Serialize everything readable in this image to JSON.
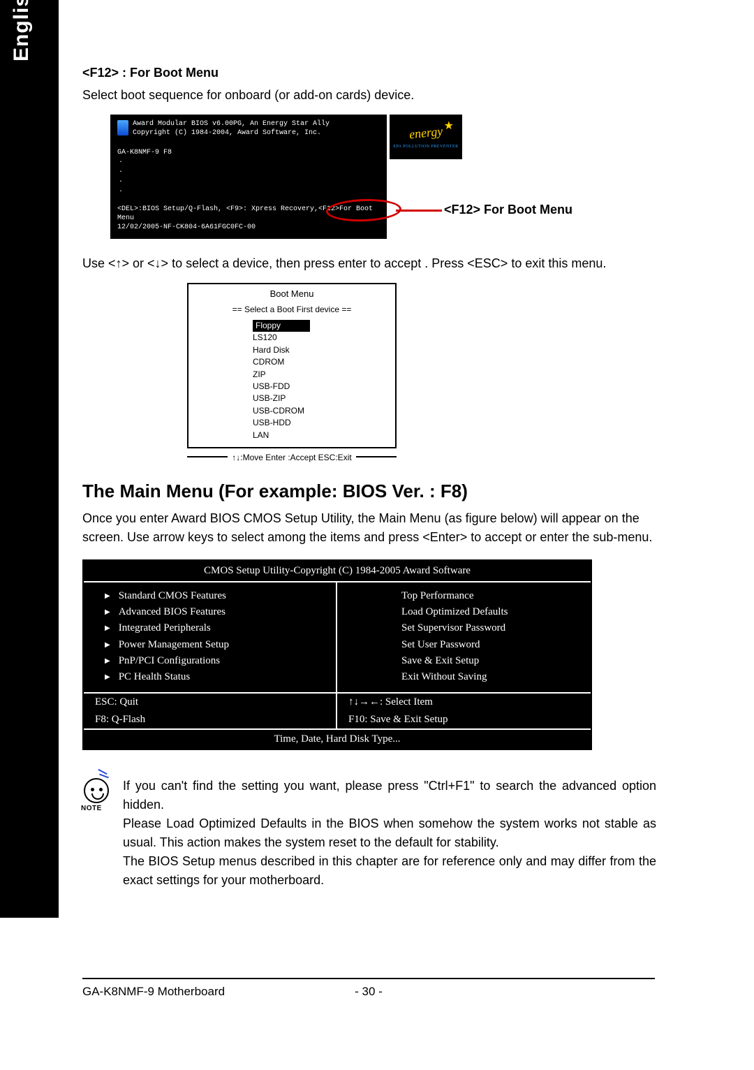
{
  "language_tab": "English",
  "section1": {
    "heading": "<F12> : For Boot Menu",
    "desc": "Select boot sequence for onboard (or add-on cards) device."
  },
  "bios_post": {
    "line1": "Award Modular BIOS v6.00PG, An Energy Star Ally",
    "line2": "Copyright (C) 1984-2004, Award Software, Inc.",
    "model": "GA-K8NMF-9 F8",
    "foot1a": "<DEL>:BIOS Setup/Q-Flash, <F9>: Xpress Recovery,",
    "foot1b": "<F12>For Boot Menu",
    "foot2": "12/02/2005-NF-CK804-6A61FGC0FC-00",
    "energy_script": "energy",
    "energy_sub": "EPA POLLUTION PREVENTER",
    "callout": "<F12> For Boot Menu"
  },
  "instruction": "Use <↑> or <↓> to select a device, then press enter to accept . Press <ESC> to exit this menu.",
  "boot_menu": {
    "title": "Boot Menu",
    "subtitle": "== Select a Boot First device ==",
    "items": [
      "Floppy",
      "LS120",
      "Hard Disk",
      "CDROM",
      "ZIP",
      "USB-FDD",
      "USB-ZIP",
      "USB-CDROM",
      "USB-HDD",
      "LAN"
    ],
    "footer": "↑↓:Move  Enter :Accept  ESC:Exit"
  },
  "section2": {
    "heading": "The Main Menu (For example: BIOS Ver. : F8)",
    "desc": "Once you enter Award BIOS CMOS Setup Utility, the Main Menu (as figure below) will appear on the screen. Use arrow keys to select among the items and press <Enter> to accept or enter the sub-menu."
  },
  "cmos": {
    "title": "CMOS Setup Utility-Copyright (C) 1984-2005 Award Software",
    "left": [
      "Standard CMOS Features",
      "Advanced BIOS Features",
      "Integrated Peripherals",
      "Power Management Setup",
      "PnP/PCI Configurations",
      "PC Health Status"
    ],
    "right": [
      "Top Performance",
      "Load Optimized Defaults",
      "Set Supervisor Password",
      "Set User Password",
      "Save & Exit Setup",
      "Exit Without Saving"
    ],
    "nav": {
      "esc": "ESC: Quit",
      "arrows": "↑↓→←: Select Item",
      "f8": "F8: Q-Flash",
      "f10": "F10: Save & Exit Setup"
    },
    "help": "Time, Date, Hard Disk Type..."
  },
  "note": {
    "label": "NOTE",
    "p1": "If you can't find the setting you want, please press \"Ctrl+F1\" to search the advanced option hidden.",
    "p2": "Please Load Optimized Defaults in the BIOS when somehow the system works not stable as usual. This action makes the system reset to the default for stability.",
    "p3": "The BIOS Setup menus described in this chapter are for reference only and may differ from the exact settings for your motherboard."
  },
  "footer": {
    "left": "GA-K8NMF-9 Motherboard",
    "center": "- 30 -"
  }
}
